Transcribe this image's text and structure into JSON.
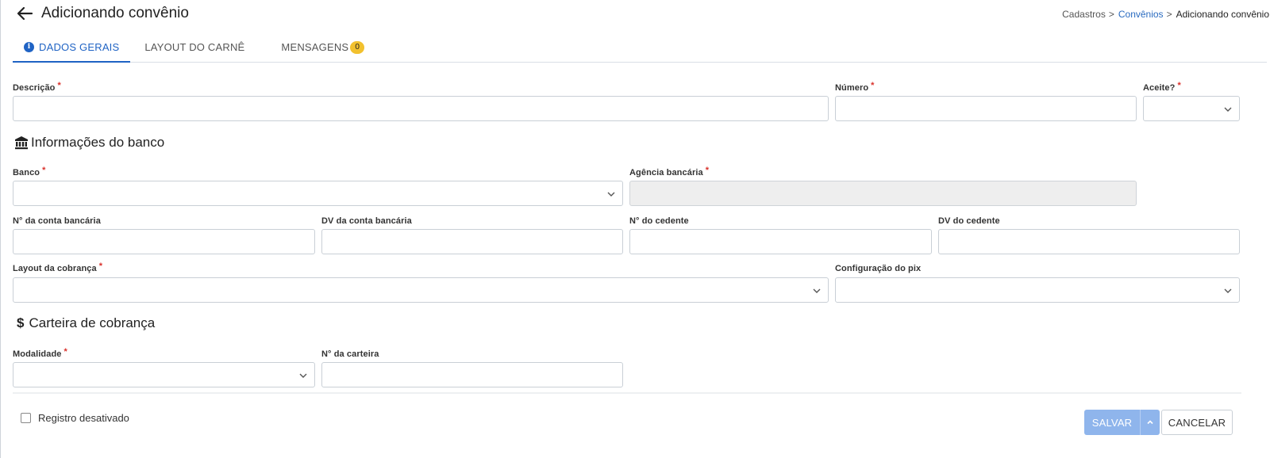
{
  "header": {
    "title": "Adicionando convênio"
  },
  "breadcrumb": {
    "items": [
      "Cadastros",
      "Convênios",
      "Adicionando convênio"
    ],
    "separator": ">"
  },
  "tabs": [
    {
      "label": "DADOS GERAIS",
      "active": true,
      "icon": "info-icon"
    },
    {
      "label": "LAYOUT DO CARNÊ",
      "active": false
    },
    {
      "label": "MENSAGENS",
      "active": false,
      "badge": "0"
    }
  ],
  "form": {
    "descricao": {
      "label": "Descrição",
      "required": "*",
      "value": ""
    },
    "numero": {
      "label": "Número",
      "required": "*",
      "value": ""
    },
    "aceite": {
      "label": "Aceite?",
      "required": "*",
      "value": ""
    },
    "banco": {
      "label": "Banco",
      "required": "*",
      "value": ""
    },
    "agencia": {
      "label": "Agência bancária",
      "required": "*",
      "value": ""
    },
    "conta": {
      "label": "N° da conta bancária",
      "value": ""
    },
    "dv_conta": {
      "label": "DV da conta bancária",
      "value": ""
    },
    "cedente": {
      "label": "N° do cedente",
      "value": ""
    },
    "dv_cedente": {
      "label": "DV do cedente",
      "value": ""
    },
    "layout_cobranca": {
      "label": "Layout da cobrança",
      "required": "*",
      "value": ""
    },
    "config_pix": {
      "label": "Configuração do pix",
      "value": ""
    },
    "modalidade": {
      "label": "Modalidade",
      "required": "*",
      "value": ""
    },
    "carteira": {
      "label": "N° da carteira",
      "value": ""
    }
  },
  "sections": {
    "banco": {
      "title": "Informações do banco",
      "icon": "bank-icon"
    },
    "carteira": {
      "title": "Carteira de cobrança",
      "icon": "dollar-icon",
      "symbol": "$"
    }
  },
  "footer": {
    "registro_desativado": {
      "label": "Registro desativado",
      "checked": false
    },
    "save_label": "SALVAR",
    "cancel_label": "CANCELAR"
  },
  "colors": {
    "accent": "#1f63c4",
    "required": "#d9312b",
    "badge": "#f2c12e",
    "save_button": "#8fb5ec"
  }
}
